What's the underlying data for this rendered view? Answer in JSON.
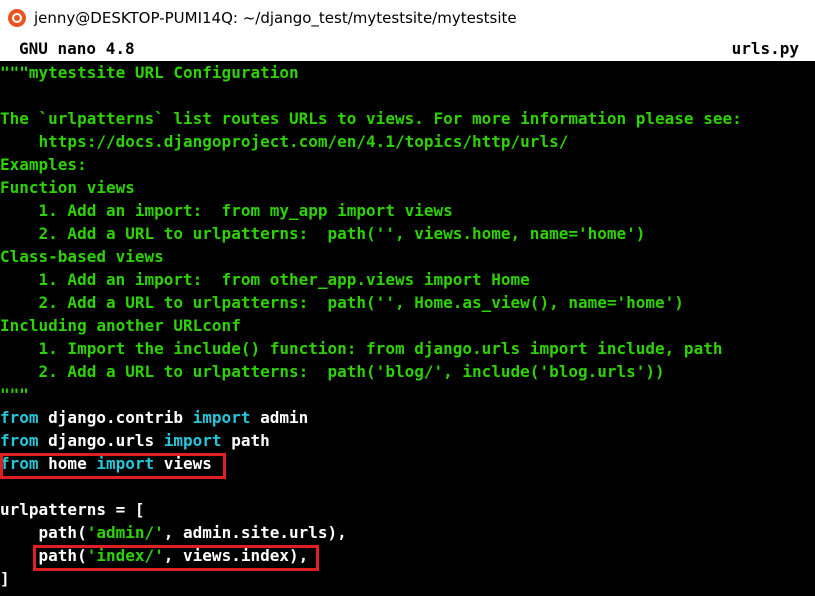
{
  "window": {
    "title": "jenny@DESKTOP-PUMI14Q: ~/django_test/mytestsite/mytestsite",
    "icon": "ubuntu-icon"
  },
  "nano": {
    "version": "GNU nano 4.8",
    "filename": "urls.py"
  },
  "code": {
    "l1": "\"\"\"mytestsite URL Configuration",
    "l3": "The `urlpatterns` list routes URLs to views. For more information please see:",
    "l4": "    https://docs.djangoproject.com/en/4.1/topics/http/urls/",
    "l5": "Examples:",
    "l6": "Function views",
    "l7": "    1. Add an import:  from my_app import views",
    "l8": "    2. Add a URL to urlpatterns:  path('', views.home, name='home')",
    "l9": "Class-based views",
    "l10": "    1. Add an import:  from other_app.views import Home",
    "l11": "    2. Add a URL to urlpatterns:  path('', Home.as_view(), name='home')",
    "l12": "Including another URLconf",
    "l13": "    1. Import the include() function: from django.urls import include, path",
    "l14": "    2. Add a URL to urlpatterns:  path('blog/', include('blog.urls'))",
    "l15": "\"\"\"",
    "l16": {
      "from": "from",
      "mod": " django.contrib ",
      "imp": "import",
      "name": " admin"
    },
    "l17": {
      "from": "from",
      "mod": " django.urls ",
      "imp": "import",
      "name": " path"
    },
    "l18": {
      "from": "from",
      "mod": " home ",
      "imp": "import",
      "name": " views"
    },
    "l20": "urlpatterns = [",
    "l21": {
      "pre": "    path(",
      "str": "'admin/'",
      "post": ", admin.site.urls),"
    },
    "l22": {
      "pre": "    path(",
      "str": "'index/'",
      "post": ", views.index),"
    },
    "l23": "]"
  },
  "colors": {
    "docstring": "#2dd200",
    "keyword": "#26c6da",
    "text": "#ffffff",
    "highlight": "#e02020"
  }
}
